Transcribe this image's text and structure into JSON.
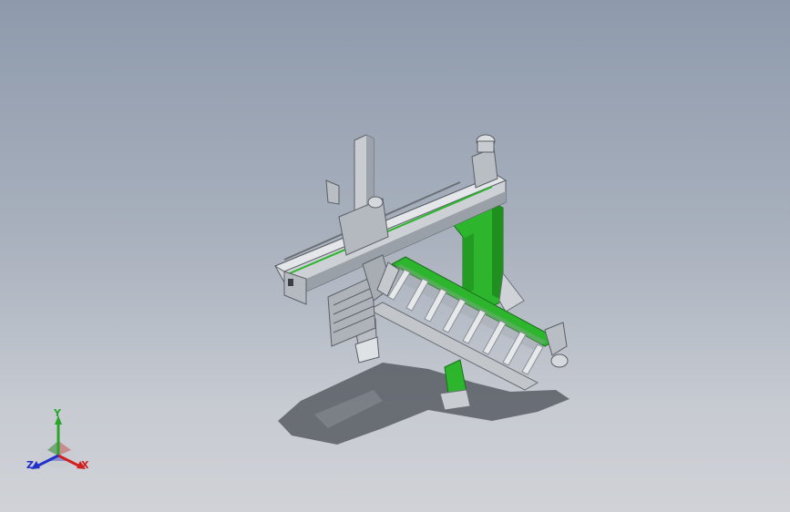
{
  "viewport": {
    "background_top": "#8e9aac",
    "background_bottom": "#d0d2d7"
  },
  "model": {
    "frame_color": "#2db52d",
    "steel_color": "#b9bec4",
    "roller_color": "#e6e8ea",
    "shadow_color": "#4a4e55"
  },
  "triad": {
    "x_label": "X",
    "y_label": "Y",
    "z_label": "Z",
    "x_color": "#d02020",
    "y_color": "#2aa52a",
    "z_color": "#2030c8"
  }
}
